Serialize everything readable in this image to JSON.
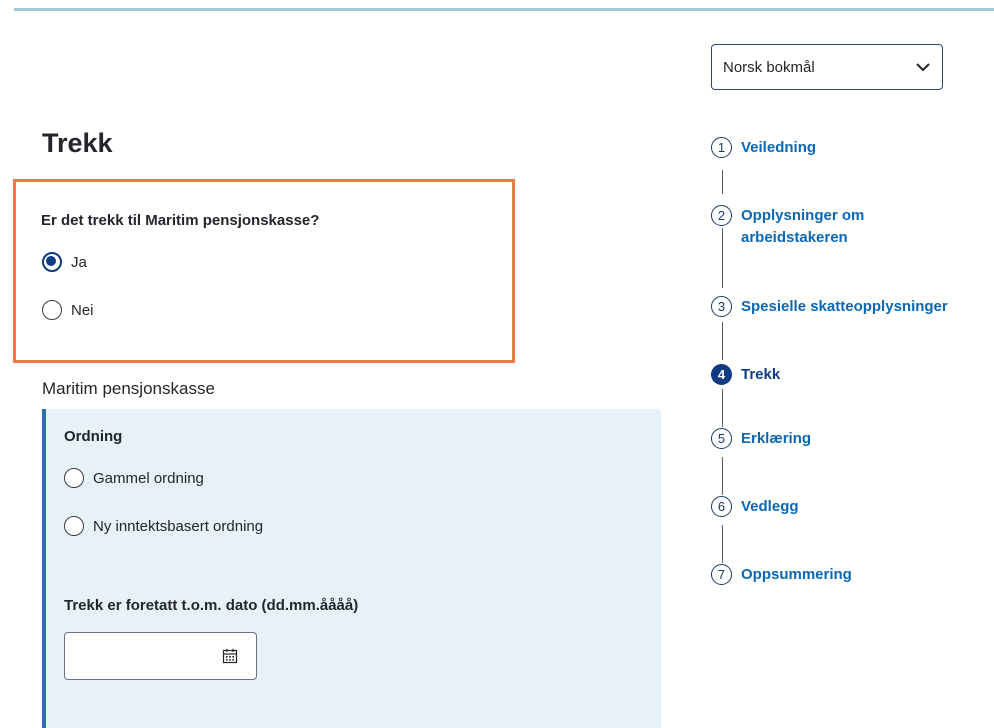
{
  "language_select": {
    "value": "Norsk bokmål"
  },
  "page_title": "Trekk",
  "question": {
    "label": "Er det trekk til Maritim pensjonskasse?",
    "options": [
      {
        "label": "Ja",
        "checked": true
      },
      {
        "label": "Nei",
        "checked": false
      }
    ]
  },
  "section": {
    "label": "Maritim pensjonskasse",
    "ordning": {
      "label": "Ordning",
      "options": [
        {
          "label": "Gammel ordning",
          "checked": false
        },
        {
          "label": "Ny inntektsbasert ordning",
          "checked": false
        }
      ]
    },
    "date_field": {
      "label": "Trekk er foretatt t.o.m. dato (dd.mm.åååå)",
      "value": ""
    }
  },
  "stepper": {
    "steps": [
      {
        "number": "1",
        "label": "Veiledning"
      },
      {
        "number": "2",
        "label": "Opplysninger om arbeidstakeren"
      },
      {
        "number": "3",
        "label": "Spesielle skatteopplysninger"
      },
      {
        "number": "4",
        "label": "Trekk"
      },
      {
        "number": "5",
        "label": "Erklæring"
      },
      {
        "number": "6",
        "label": "Vedlegg"
      },
      {
        "number": "7",
        "label": "Oppsummering"
      }
    ]
  },
  "colors": {
    "accent": "#0f3b82",
    "link": "#0b67b4",
    "highlight_border": "#ef7a4a",
    "panel_bg": "#e6f1f8",
    "panel_border": "#2e6ea8"
  }
}
